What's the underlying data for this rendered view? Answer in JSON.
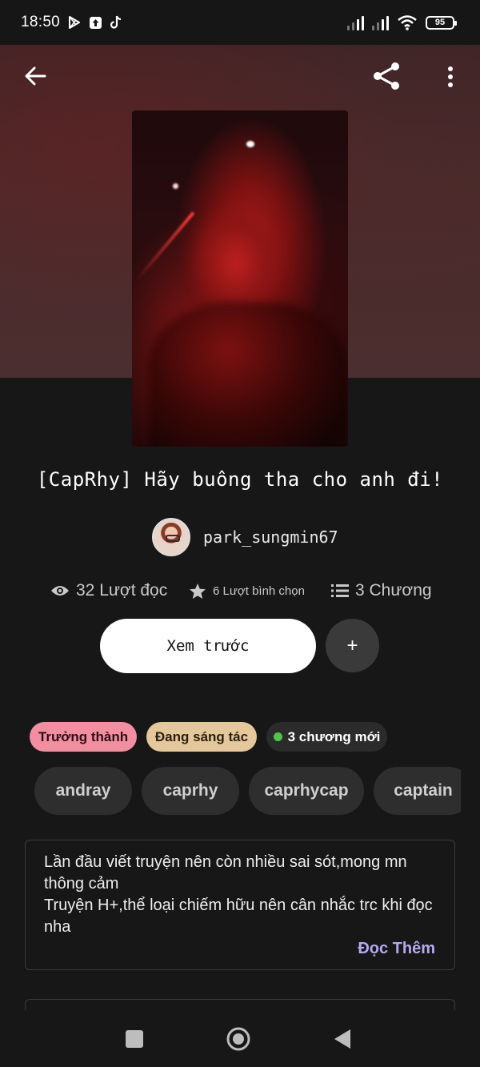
{
  "status_bar": {
    "time": "18:50",
    "battery": "95",
    "left_icons": [
      "play-store-icon",
      "upload-icon",
      "tiktok-icon"
    ],
    "right_icons": [
      "signal-icon",
      "signal-icon",
      "wifi-icon",
      "battery-icon"
    ]
  },
  "toolbar": {
    "back_icon": "arrow-left-icon",
    "share_icon": "share-icon",
    "more_icon": "more-vertical-icon"
  },
  "story": {
    "title": "[CapRhy] Hãy buông tha cho anh đi!",
    "author": "park_sungmin67",
    "stats": {
      "reads": "32 Lượt đọc",
      "votes": "6 Lượt bình chọn",
      "parts": "3 Chương"
    },
    "preview_label": "Xem trước",
    "add_label": "+",
    "badges": {
      "mature": "Trưởng thành",
      "ongoing": "Đang sáng tác",
      "new_parts": "3 chương mới"
    },
    "tags": [
      "andray",
      "caprhy",
      "caprhycap",
      "captain"
    ],
    "description": "Lần đầu viết truyện nên còn nhiều sai sót,mong mn thông cảm\nTruyện H+,thể loại chiếm hữu nên cân nhắc trc khi đọc nha",
    "read_more": "Đọc Thêm"
  },
  "colors": {
    "background": "#171717",
    "hero": "#4a2b2c",
    "mature_badge": "#f28ea0",
    "ongoing_badge": "#e4c89b",
    "new_dot": "#52c34a",
    "read_more": "#b6a8f2"
  },
  "nav_bar": {
    "recents_icon": "square-icon",
    "home_icon": "circle-icon",
    "back_icon": "triangle-back-icon"
  }
}
